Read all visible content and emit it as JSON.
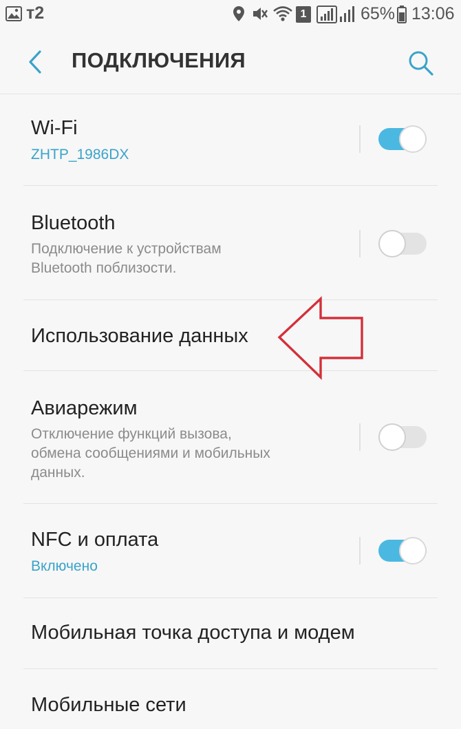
{
  "status_bar": {
    "carrier": "т2",
    "sim_slot": "1",
    "battery": "65%",
    "time": "13:06",
    "icons": [
      "image-icon",
      "location-icon",
      "mute-icon",
      "wifi-icon",
      "sim-icon",
      "signal-icon",
      "battery-icon"
    ]
  },
  "header": {
    "title": "ПОДКЛЮЧЕНИЯ",
    "back_icon": "chevron-left-icon",
    "search_icon": "search-icon"
  },
  "settings": {
    "wifi": {
      "title": "Wi-Fi",
      "subtitle": "ZHTP_1986DX",
      "enabled": true
    },
    "bluetooth": {
      "title": "Bluetooth",
      "subtitle_line1": "Подключение к устройствам",
      "subtitle_line2": "Bluetooth поблизости.",
      "enabled": false
    },
    "data_usage": {
      "title": "Использование данных"
    },
    "airplane": {
      "title": "Авиарежим",
      "subtitle_line1": "Отключение функций вызова,",
      "subtitle_line2": "обмена сообщениями и мобильных",
      "subtitle_line3": "данных.",
      "enabled": false
    },
    "nfc": {
      "title": "NFC и оплата",
      "subtitle": "Включено",
      "enabled": true
    },
    "hotspot": {
      "title": "Мобильная точка доступа и модем"
    },
    "mobile_networks": {
      "title": "Мобильные сети"
    }
  },
  "colors": {
    "accent": "#3aa3c9",
    "toggle_on": "#4bb8e2",
    "annotation_arrow": "#d3303a"
  }
}
